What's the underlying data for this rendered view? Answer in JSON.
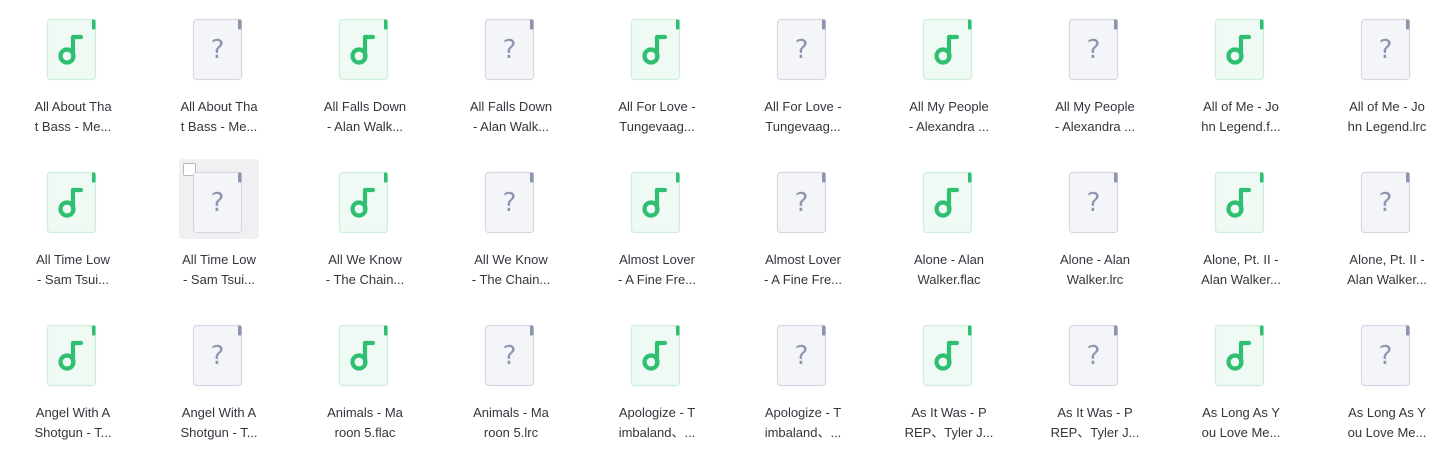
{
  "colors": {
    "music_accent": "#2fbf71",
    "music_bg": "#eefaf3",
    "music_border": "#cdeedb",
    "unknown_accent": "#8d95b0",
    "unknown_bg": "#f4f5f9",
    "unknown_border": "#d5d8e2",
    "text": "#33363d"
  },
  "files": [
    {
      "type": "music",
      "icon": "music-note-icon",
      "line1": "All About Tha",
      "line2": "t Bass - Me..."
    },
    {
      "type": "unknown",
      "icon": "question-mark-icon",
      "line1": "All About Tha",
      "line2": "t Bass - Me..."
    },
    {
      "type": "music",
      "icon": "music-note-icon",
      "line1": "All Falls Down",
      "line2": "- Alan Walk..."
    },
    {
      "type": "unknown",
      "icon": "question-mark-icon",
      "line1": "All Falls Down",
      "line2": "- Alan Walk..."
    },
    {
      "type": "music",
      "icon": "music-note-icon",
      "line1": "All For Love -",
      "line2": "Tungevaag..."
    },
    {
      "type": "unknown",
      "icon": "question-mark-icon",
      "line1": "All For Love -",
      "line2": "Tungevaag..."
    },
    {
      "type": "music",
      "icon": "music-note-icon",
      "line1": "All My People",
      "line2": "- Alexandra ..."
    },
    {
      "type": "unknown",
      "icon": "question-mark-icon",
      "line1": "All My People",
      "line2": "- Alexandra ..."
    },
    {
      "type": "music",
      "icon": "music-note-icon",
      "line1": "All of Me - Jo",
      "line2": "hn Legend.f..."
    },
    {
      "type": "unknown",
      "icon": "question-mark-icon",
      "line1": "All of Me - Jo",
      "line2": "hn Legend.lrc"
    },
    {
      "type": "music",
      "icon": "music-note-icon",
      "line1": "All Time Low",
      "line2": "- Sam Tsui..."
    },
    {
      "type": "unknown",
      "icon": "question-mark-icon",
      "line1": "All Time Low",
      "line2": "- Sam Tsui...",
      "selected": true
    },
    {
      "type": "music",
      "icon": "music-note-icon",
      "line1": "All We Know",
      "line2": "- The Chain..."
    },
    {
      "type": "unknown",
      "icon": "question-mark-icon",
      "line1": "All We Know",
      "line2": "- The Chain..."
    },
    {
      "type": "music",
      "icon": "music-note-icon",
      "line1": "Almost Lover",
      "line2": "- A Fine Fre..."
    },
    {
      "type": "unknown",
      "icon": "question-mark-icon",
      "line1": "Almost Lover",
      "line2": "- A Fine Fre..."
    },
    {
      "type": "music",
      "icon": "music-note-icon",
      "line1": "Alone - Alan",
      "line2": "Walker.flac"
    },
    {
      "type": "unknown",
      "icon": "question-mark-icon",
      "line1": "Alone - Alan",
      "line2": "Walker.lrc"
    },
    {
      "type": "music",
      "icon": "music-note-icon",
      "line1": "Alone, Pt. II -",
      "line2": "Alan Walker..."
    },
    {
      "type": "unknown",
      "icon": "question-mark-icon",
      "line1": "Alone, Pt. II -",
      "line2": "Alan Walker..."
    },
    {
      "type": "music",
      "icon": "music-note-icon",
      "line1": "Angel With A",
      "line2": "Shotgun - T..."
    },
    {
      "type": "unknown",
      "icon": "question-mark-icon",
      "line1": "Angel With A",
      "line2": "Shotgun - T..."
    },
    {
      "type": "music",
      "icon": "music-note-icon",
      "line1": "Animals - Ma",
      "line2": "roon 5.flac"
    },
    {
      "type": "unknown",
      "icon": "question-mark-icon",
      "line1": "Animals - Ma",
      "line2": "roon 5.lrc"
    },
    {
      "type": "music",
      "icon": "music-note-icon",
      "line1": "Apologize - T",
      "line2": "imbaland、..."
    },
    {
      "type": "unknown",
      "icon": "question-mark-icon",
      "line1": "Apologize - T",
      "line2": "imbaland、..."
    },
    {
      "type": "music",
      "icon": "music-note-icon",
      "line1": "As It Was - P",
      "line2": "REP、Tyler J..."
    },
    {
      "type": "unknown",
      "icon": "question-mark-icon",
      "line1": "As It Was - P",
      "line2": "REP、Tyler J..."
    },
    {
      "type": "music",
      "icon": "music-note-icon",
      "line1": "As Long As Y",
      "line2": "ou Love Me..."
    },
    {
      "type": "unknown",
      "icon": "question-mark-icon",
      "line1": "As Long As Y",
      "line2": "ou Love Me..."
    }
  ]
}
